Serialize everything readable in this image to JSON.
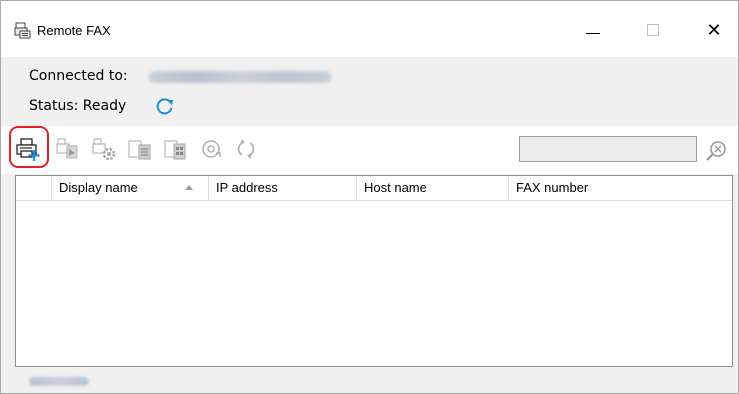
{
  "window": {
    "title": "Remote FAX",
    "close_glyph": "✕"
  },
  "info": {
    "connected_label": "Connected to:",
    "status_label": "Status:",
    "status_value": "Ready"
  },
  "toolbar": {
    "icons": [
      "add-printer-icon",
      "edit-printer-icon",
      "printer-settings-icon",
      "fax-list-icon",
      "fax-log-icon",
      "import-icon",
      "refresh-icon"
    ],
    "search_placeholder": ""
  },
  "table": {
    "columns": [
      "",
      "Display name",
      "IP address",
      "Host name",
      "FAX number"
    ],
    "sort_column": "Display name",
    "sort_direction": "ascending",
    "rows": []
  },
  "colors": {
    "highlight": "#e0202a",
    "accent": "#1e90d6"
  }
}
